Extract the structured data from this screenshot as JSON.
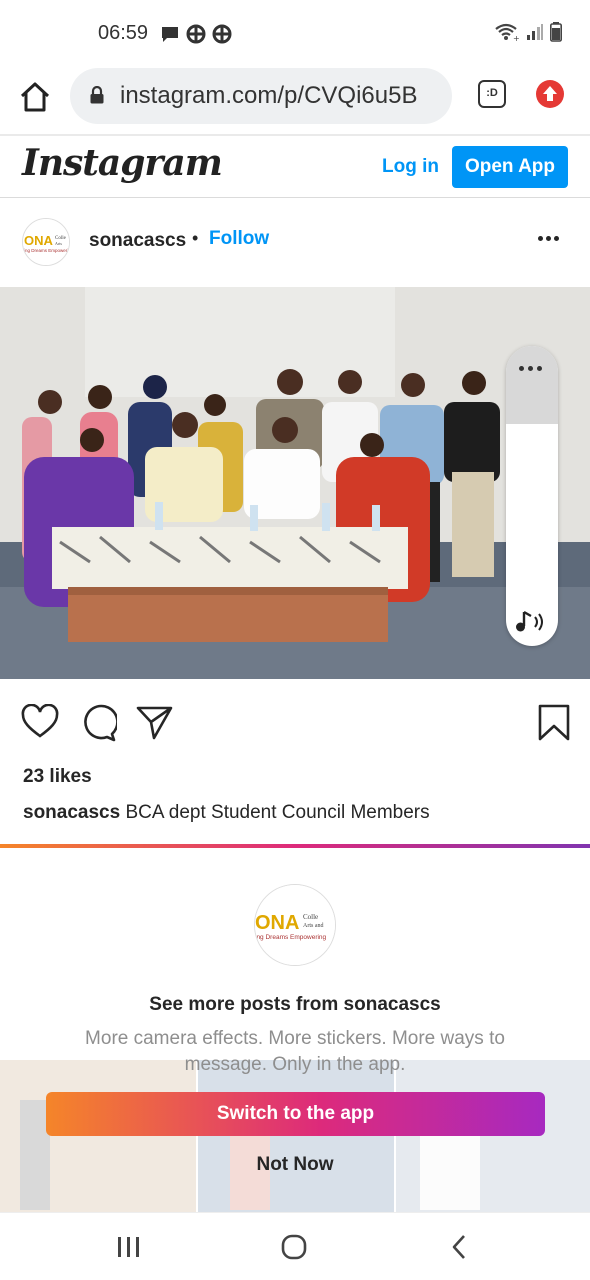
{
  "status_bar": {
    "time": "06:59",
    "left_icons": [
      "message-icon",
      "gallery-icon",
      "gallery-icon"
    ],
    "right_icons": [
      "wifi-icon",
      "signal-icon",
      "battery-icon"
    ]
  },
  "browser": {
    "url": "instagram.com/p/CVQi6u5B",
    "tab_label": ":D",
    "home_icon": "home-icon",
    "lock_icon": "lock-icon",
    "upload_icon": "upload-icon",
    "upload_color": "#e53935"
  },
  "instagram_header": {
    "logo": "Instagram",
    "login_label": "Log in",
    "open_app_label": "Open App",
    "accent_color": "#0095f6"
  },
  "post": {
    "username": "sonacascs",
    "separator": "•",
    "follow_label": "Follow",
    "avatar_text": "ONA",
    "avatar_subtext": "ing Dreams Empowering",
    "likes": "23 likes",
    "caption_user": "sonacascs",
    "caption_text": "BCA dept Student Council Members",
    "volume_level": 0.74
  },
  "sheet": {
    "avatar_text": "ONA",
    "avatar_side": "Colle Arts and",
    "avatar_subtext": "ing Dreams Empowering",
    "title": "See more posts from sonacascs",
    "subtitle": "More camera effects. More stickers. More ways to message. Only in the app.",
    "switch_label": "Switch to the app",
    "not_now_label": "Not Now"
  },
  "nav": {
    "icons": [
      "recent-apps-icon",
      "home-circle-icon",
      "back-icon"
    ]
  }
}
